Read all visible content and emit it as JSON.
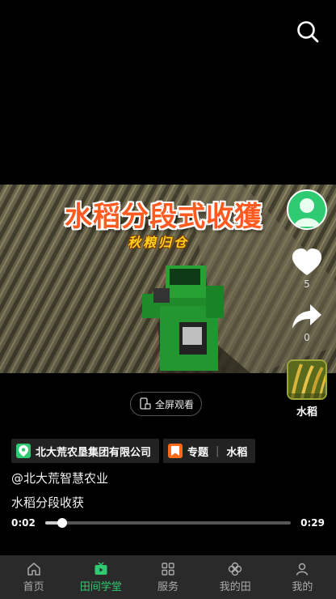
{
  "header": {
    "search_icon": "search-icon"
  },
  "video": {
    "title": "水稻分段式收獲",
    "subtitle": "秋粮归仓"
  },
  "actions": {
    "like_count": "5",
    "share_count": "0",
    "topic_label": "水稻"
  },
  "fullscreen": {
    "label": "全屏观看"
  },
  "tags": {
    "location": "北大荒农垦集团有限公司",
    "topic_prefix": "专题",
    "topic_name": "水稻"
  },
  "author": "@北大荒智慧农业",
  "description": "水稻分段收获",
  "player": {
    "current_time": "0:02",
    "duration": "0:29",
    "progress": 0.069
  },
  "tabbar": {
    "items": [
      {
        "label": "首页",
        "icon": "home-icon"
      },
      {
        "label": "田间学堂",
        "icon": "tv-icon",
        "active": true
      },
      {
        "label": "服务",
        "icon": "grid-icon"
      },
      {
        "label": "我的田",
        "icon": "clover-icon"
      },
      {
        "label": "我的",
        "icon": "person-icon"
      }
    ]
  },
  "colors": {
    "accent": "#2fcb73",
    "title": "#ff5a1f",
    "subtitle": "#ffd21a"
  }
}
